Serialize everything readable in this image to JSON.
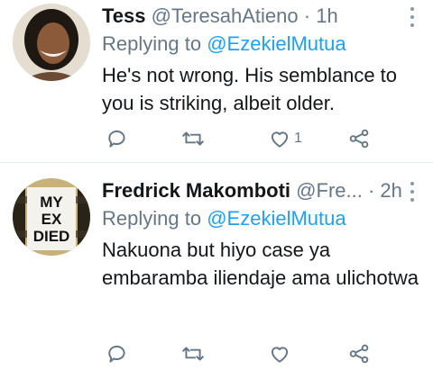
{
  "tweets": [
    {
      "name": "Tess",
      "handle": "@TeresahAtieno",
      "dot": "·",
      "time": "1h",
      "replying_prefix": "Replying to",
      "replying_to": "@EzekielMutua",
      "text": "He's not wrong. His semblance to you is striking, albeit older.",
      "like_count": "1",
      "icons": [
        "reply-icon",
        "retweet-icon",
        "like-icon",
        "share-icon",
        "more-icon"
      ]
    },
    {
      "name": "Fredrick Makomboti",
      "handle": "@Fre...",
      "dot": "·",
      "time": "2h",
      "replying_prefix": "Replying to",
      "replying_to": "@EzekielMutua",
      "text": "Nakuona but hiyo case ya embaramba iliendaje ama ulichotwa",
      "like_count": "",
      "avatar_text": [
        "MY",
        "EX",
        "DIED"
      ],
      "icons": [
        "reply-icon",
        "retweet-icon",
        "like-icon",
        "share-icon",
        "more-icon"
      ]
    }
  ],
  "colors": {
    "text": "#14171a",
    "secondary": "#657786",
    "mention": "#1da1f2",
    "divider": "#e6ecf0"
  }
}
